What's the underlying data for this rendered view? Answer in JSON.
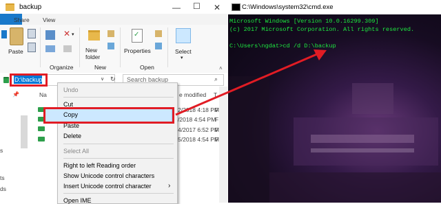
{
  "explorer": {
    "title": "backup",
    "tabs": [
      "Share",
      "View"
    ],
    "ribbon": {
      "paste": "Paste",
      "new_folder": "New\nfolder",
      "properties": "Properties",
      "select": "Select",
      "groups": [
        "Organize",
        "New",
        "Open"
      ]
    },
    "address": {
      "value": "D:\\backup",
      "placeholder": "Search backup"
    },
    "columns": {
      "name": "Na",
      "modified": "e modified",
      "type": "T"
    },
    "rows": [
      {
        "date": "2/2018 4:18 PM",
        "type": "F"
      },
      {
        "date": "/2018 4:54 PM",
        "type": "F"
      },
      {
        "date": "4/2017 6:52 PM",
        "type": "F"
      },
      {
        "date": "5/2018 4:54 PM",
        "type": "F"
      }
    ],
    "left_fragments": [
      "s",
      "ts",
      "ds"
    ]
  },
  "context_menu": {
    "items": [
      "Undo",
      "Cut",
      "Copy",
      "Paste",
      "Delete",
      "Select All",
      "Right to left Reading order",
      "Show Unicode control characters",
      "Insert Unicode control character",
      "Open IME"
    ],
    "highlighted": "Copy",
    "submenu_arrow": "›"
  },
  "cmd": {
    "title": "C:\\Windows\\system32\\cmd.exe",
    "lines": [
      "Microsoft Windows [Version 10.0.16299.309]",
      "(c) 2017 Microsoft Corporation. All rights reserved.",
      "",
      "C:\\Users\\ngdat>cd /d D:\\backup"
    ],
    "text_color": "#1ee840"
  },
  "colors": {
    "accent": "#0078d7",
    "annotation_red": "#e11c24"
  }
}
